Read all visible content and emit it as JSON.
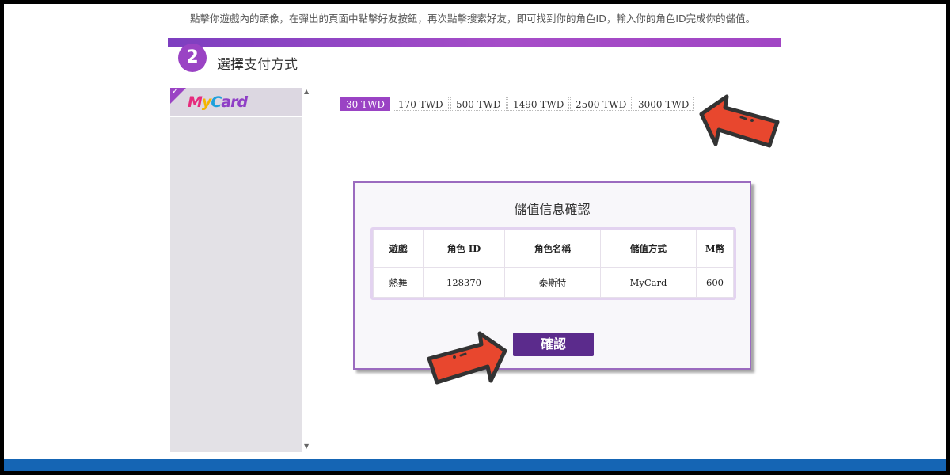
{
  "instruction": "點擊你遊戲內的頭像，在彈出的頁面中點擊好友按鈕，再次點擊搜索好友，即可找到你的角色ID，輸入你的角色ID完成你的儲值。",
  "step": {
    "number": "2",
    "title": "選擇支付方式"
  },
  "payment_methods": [
    {
      "name": "MyCard",
      "selected": true,
      "icon": "mycard-logo"
    }
  ],
  "amounts": [
    {
      "label": "30 TWD",
      "selected": true
    },
    {
      "label": "170 TWD",
      "selected": false
    },
    {
      "label": "500 TWD",
      "selected": false
    },
    {
      "label": "1490 TWD",
      "selected": false
    },
    {
      "label": "2500 TWD",
      "selected": false
    },
    {
      "label": "3000 TWD",
      "selected": false
    }
  ],
  "dialog": {
    "title": "儲值信息確認",
    "headers": [
      "遊戲",
      "角色 ID",
      "角色名稱",
      "儲值方式",
      "M幣"
    ],
    "row": [
      "熱舞",
      "128370",
      "泰斯特",
      "MyCard",
      "600"
    ],
    "confirm_label": "確認"
  },
  "colors": {
    "accent": "#9a43c4",
    "button": "#5b2b8c",
    "footer": "#1565b4",
    "arrow": "#e8472e"
  }
}
